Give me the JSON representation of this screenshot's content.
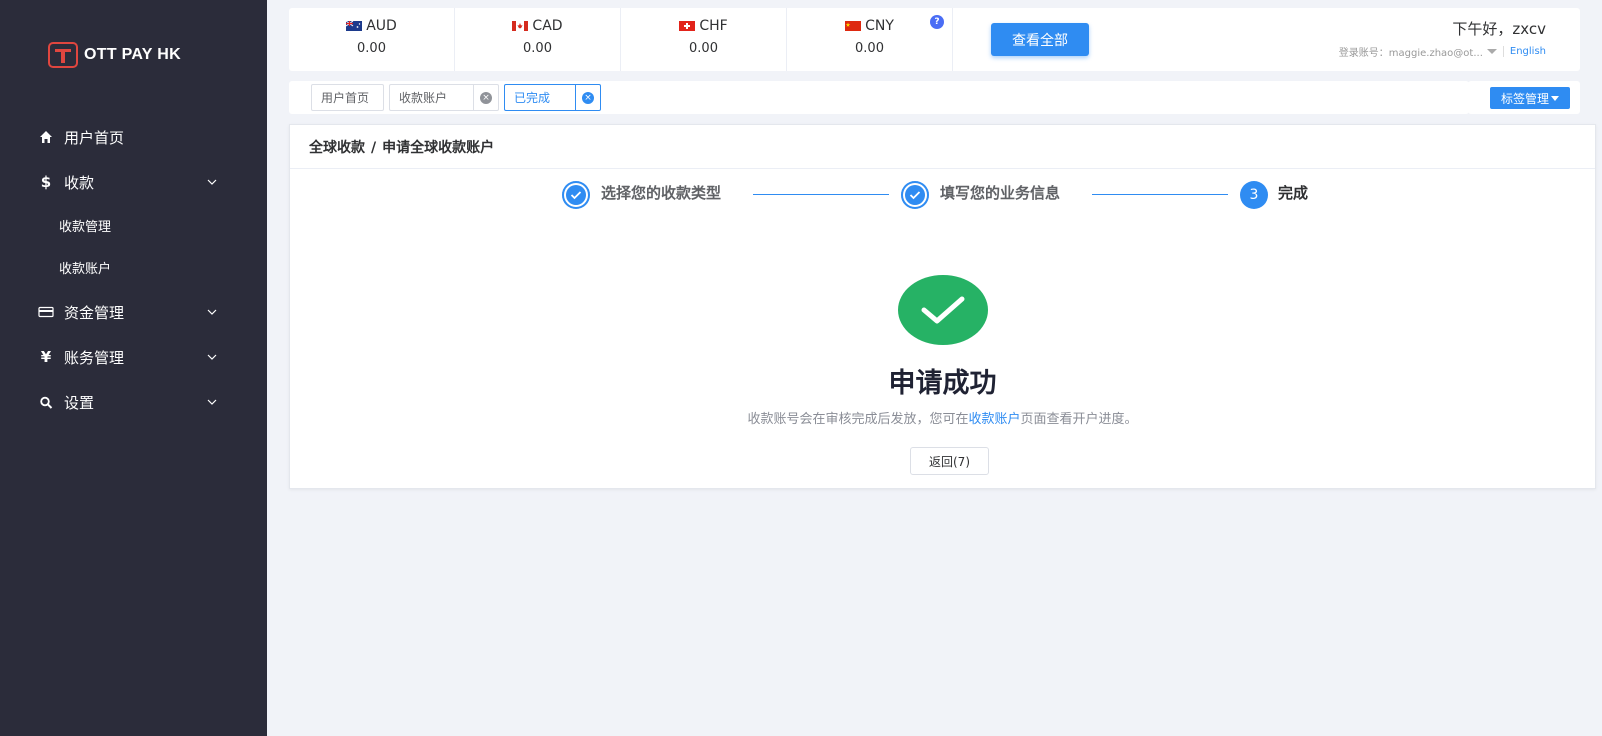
{
  "brand": {
    "logo_text": "OTT PAY HK"
  },
  "sidebar": {
    "items": [
      {
        "label": "用户首页",
        "icon": "home-icon"
      },
      {
        "label": "收款",
        "icon": "dollar-icon"
      },
      {
        "label": "资金管理",
        "icon": "card-icon"
      },
      {
        "label": "账务管理",
        "icon": "yen-icon"
      },
      {
        "label": "设置",
        "icon": "search-icon"
      }
    ],
    "sub_items": [
      {
        "label": "收款管理"
      },
      {
        "label": "收款账户"
      }
    ]
  },
  "balances": [
    {
      "code": "AUD",
      "value": "0.00"
    },
    {
      "code": "CAD",
      "value": "0.00"
    },
    {
      "code": "CHF",
      "value": "0.00"
    },
    {
      "code": "CNY",
      "value": "0.00"
    }
  ],
  "header": {
    "help": "?",
    "view_all": "查看全部",
    "greeting": "下午好，zxcv",
    "account_label": "登录账号：maggie.zhao@ot...",
    "language": "English"
  },
  "tabs": [
    {
      "label": "用户首页",
      "closable": false
    },
    {
      "label": "收款账户",
      "closable": true
    },
    {
      "label": "已完成",
      "closable": true,
      "active": true
    }
  ],
  "tag_manager": "标签管理",
  "main": {
    "breadcrumb": [
      "全球收款",
      "申请全球收款账户"
    ],
    "breadcrumb_sep": "/",
    "steps": [
      {
        "label": "选择您的收款类型",
        "status": "done"
      },
      {
        "label": "填写您的业务信息",
        "status": "done"
      },
      {
        "label": "完成",
        "number": "3",
        "status": "current"
      }
    ],
    "result": {
      "title": "申请成功",
      "desc_before": "收款账号会在审核完成后发放，您可在",
      "desc_link": "收款账户",
      "desc_after": "页面查看开户进度。",
      "back_button": "返回(7)"
    }
  },
  "colors": {
    "sidebar_bg": "#2b2c3a",
    "accent": "#2f8cf2",
    "success": "#26b265",
    "brand_red": "#e0463f"
  }
}
